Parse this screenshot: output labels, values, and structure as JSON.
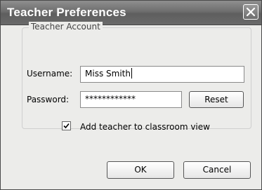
{
  "window": {
    "title": "Teacher Preferences",
    "close_icon": "close-x-icon"
  },
  "account": {
    "group_label": "Teacher Account",
    "username_label": "Username:",
    "username_value": "Miss Smith",
    "password_label": "Password:",
    "password_value": "************",
    "reset_label": "Reset",
    "checkbox_label": "Add teacher to classroom view",
    "checkbox_checked": true
  },
  "footer": {
    "ok_label": "OK",
    "cancel_label": "Cancel"
  }
}
